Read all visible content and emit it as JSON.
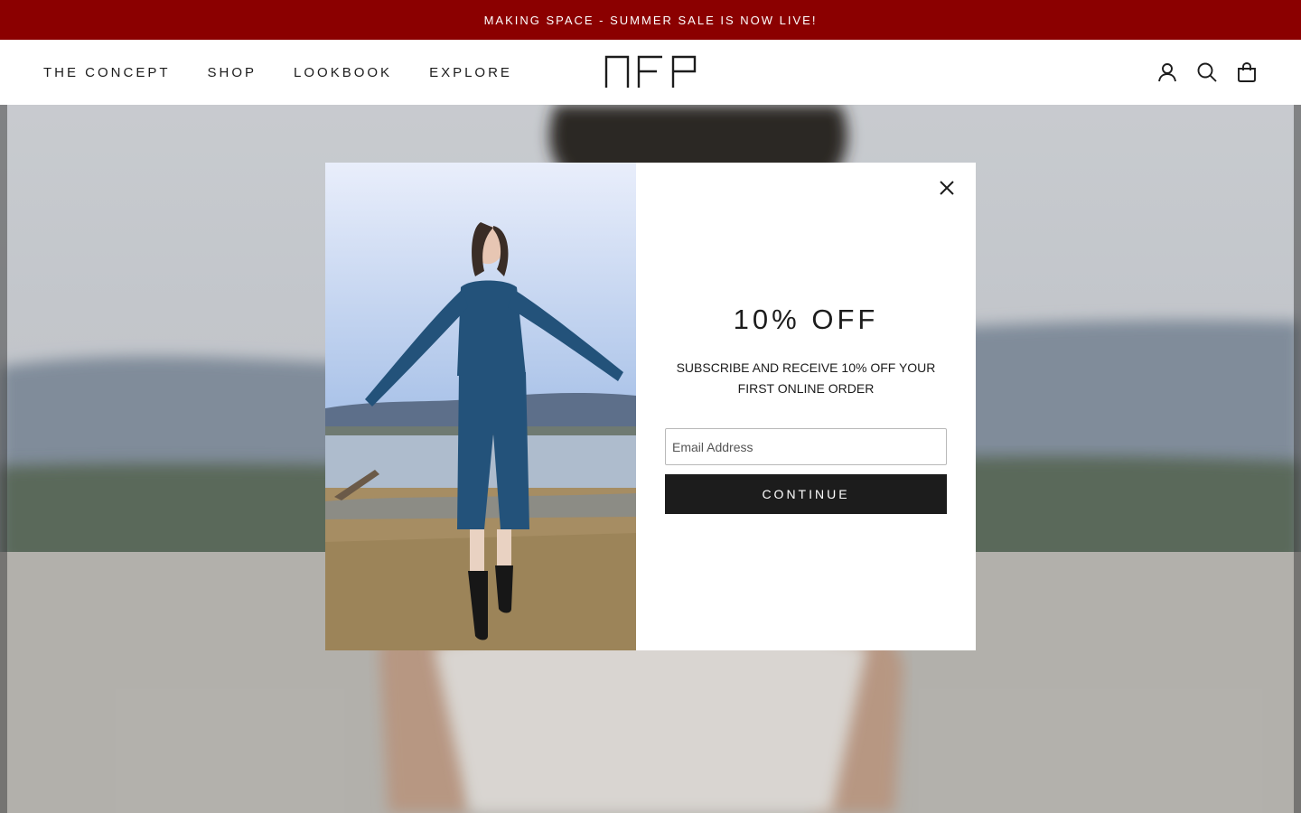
{
  "announcement": {
    "text": "MAKING SPACE - SUMMER SALE IS NOW LIVE!",
    "bg_color": "#8b0000"
  },
  "header": {
    "nav": [
      {
        "label": "THE CONCEPT"
      },
      {
        "label": "SHOP"
      },
      {
        "label": "LOOKBOOK"
      },
      {
        "label": "EXPLORE"
      }
    ],
    "logo": "NFP",
    "icons": [
      "account-icon",
      "search-icon",
      "cart-icon"
    ]
  },
  "hero": {
    "image": "model-in-white-shorts-by-lake"
  },
  "popup": {
    "image": "model-in-blue-knit-outfit-by-lake",
    "title": "10% OFF",
    "subtitle": "SUBSCRIBE AND RECEIVE 10% OFF YOUR FIRST ONLINE ORDER",
    "email_placeholder": "Email Address",
    "email_value": "",
    "button_label": "CONTINUE",
    "close_icon": "close-icon"
  }
}
